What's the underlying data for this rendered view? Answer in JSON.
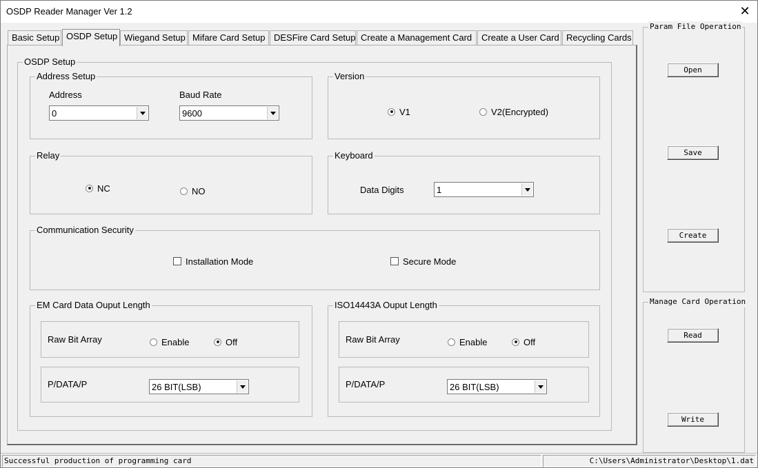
{
  "window": {
    "title": "OSDP Reader Manager Ver 1.2"
  },
  "tabs": [
    {
      "label": "Basic Setup"
    },
    {
      "label": "OSDP Setup"
    },
    {
      "label": "Wiegand Setup"
    },
    {
      "label": "Mifare Card Setup"
    },
    {
      "label": "DESFire Card Setup"
    },
    {
      "label": "Create a Management Card"
    },
    {
      "label": "Create a User Card"
    },
    {
      "label": "Recycling Cards"
    }
  ],
  "active_tab": "OSDP Setup",
  "osdp": {
    "title": "OSDP Setup",
    "address_setup": {
      "title": "Address Setup",
      "address_label": "Address",
      "address_value": "0",
      "baud_label": "Baud Rate",
      "baud_value": "9600"
    },
    "version": {
      "title": "Version",
      "v1": "V1",
      "v2": "V2(Encrypted)",
      "selected": "V1"
    },
    "relay": {
      "title": "Relay",
      "nc": "NC",
      "no": "NO",
      "selected": "NC"
    },
    "keyboard": {
      "title": "Keyboard",
      "data_digits_label": "Data Digits",
      "data_digits_value": "1"
    },
    "comm_security": {
      "title": "Communication Security",
      "installation_mode": "Installation Mode",
      "secure_mode": "Secure Mode",
      "installation_checked": false,
      "secure_checked": false
    },
    "em_card": {
      "title": "EM Card Data Ouput Length",
      "raw_bit_array_label": "Raw Bit Array",
      "enable": "Enable",
      "off": "Off",
      "selected": "Off",
      "pdata_label": "P/DATA/P",
      "pdata_value": "26 BIT(LSB)"
    },
    "iso14443a": {
      "title": "ISO14443A Ouput Length",
      "raw_bit_array_label": "Raw Bit Array",
      "enable": "Enable",
      "off": "Off",
      "selected": "Off",
      "pdata_label": "P/DATA/P",
      "pdata_value": "26 BIT(LSB)"
    }
  },
  "param_file": {
    "title": "Param File Operation",
    "open": "Open",
    "save": "Save",
    "create": "Create"
  },
  "manage_card": {
    "title": "Manage Card Operation",
    "read": "Read",
    "write": "Write"
  },
  "status": {
    "message": "Successful production of programming card",
    "path": "C:\\Users\\Administrator\\Desktop\\1.dat"
  }
}
